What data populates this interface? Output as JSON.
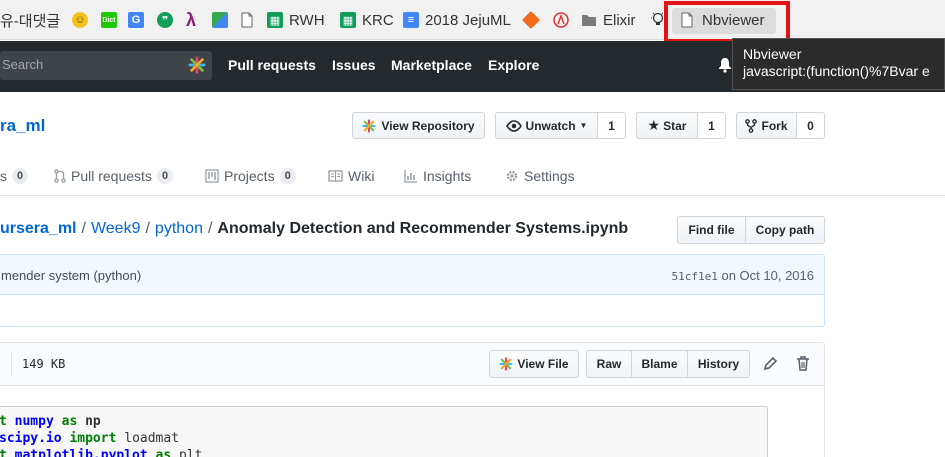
{
  "bookmarks": [
    {
      "label": "유-대댓글",
      "icon": "page-icon"
    },
    {
      "label": "",
      "icon": "smiley-icon"
    },
    {
      "label": "Dict",
      "icon": "dict-icon"
    },
    {
      "label": "",
      "icon": "translate-icon"
    },
    {
      "label": "",
      "icon": "hangouts-icon"
    },
    {
      "label": "λ",
      "icon": "lambda-icon"
    },
    {
      "label": "",
      "icon": "maps-icon"
    },
    {
      "label": "",
      "icon": "page-icon"
    },
    {
      "label": "RWH",
      "icon": "sheets-icon"
    },
    {
      "label": "KRC",
      "icon": "sheets-icon"
    },
    {
      "label": "2018 JejuML",
      "icon": "docs-icon"
    },
    {
      "label": "",
      "icon": "cube-icon"
    },
    {
      "label": "",
      "icon": "circle-logo-icon"
    },
    {
      "label": "Elixir",
      "icon": "folder-icon"
    },
    {
      "label": "",
      "icon": "bulb-icon"
    },
    {
      "label": "Nbviewer",
      "icon": "page-icon"
    }
  ],
  "tooltip": {
    "title": "Nbviewer",
    "url": "javascript:(function()%7Bvar e"
  },
  "header": {
    "search_placeholder": "Search",
    "nav": [
      "Pull requests",
      "Issues",
      "Marketplace",
      "Explore"
    ]
  },
  "repo": {
    "name_fragment": "ra_ml",
    "view_repository": "View Repository",
    "unwatch": "Unwatch",
    "unwatch_count": "1",
    "star": "Star",
    "star_count": "1",
    "fork": "Fork",
    "fork_count": "0"
  },
  "tabs": [
    {
      "label": "s",
      "count": "0"
    },
    {
      "label": "Pull requests",
      "count": "0"
    },
    {
      "label": "Projects",
      "count": "0"
    },
    {
      "label": "Wiki",
      "count": ""
    },
    {
      "label": "Insights",
      "count": ""
    },
    {
      "label": "Settings",
      "count": ""
    }
  ],
  "breadcrumb": {
    "parts": [
      "ursera_ml",
      "Week9",
      "python"
    ],
    "file": "Anomaly Detection and Recommender Systems.ipynb",
    "find_file": "Find file",
    "copy_path": "Copy path"
  },
  "commit": {
    "message": "mender system (python)",
    "sha": "51cf1e1",
    "date": "on Oct 10, 2016"
  },
  "file": {
    "size": "149 KB",
    "view_file": "View File",
    "raw": "Raw",
    "blame": "Blame",
    "history": "History"
  },
  "code": {
    "line1": {
      "kw": "t",
      "mod": "numpy",
      "kw2": "as",
      "alias": "np"
    },
    "line2": {
      "mod": "scipy.io",
      "kw": "import",
      "name": "loadmat"
    },
    "line3": {
      "kw": "t",
      "mod": "matplotlib.pyplot",
      "kw2": "as",
      "alias": "plt"
    }
  },
  "colors": {
    "highlight_box": "#e31313",
    "header_bg": "#24292e",
    "link": "#0366d6"
  }
}
